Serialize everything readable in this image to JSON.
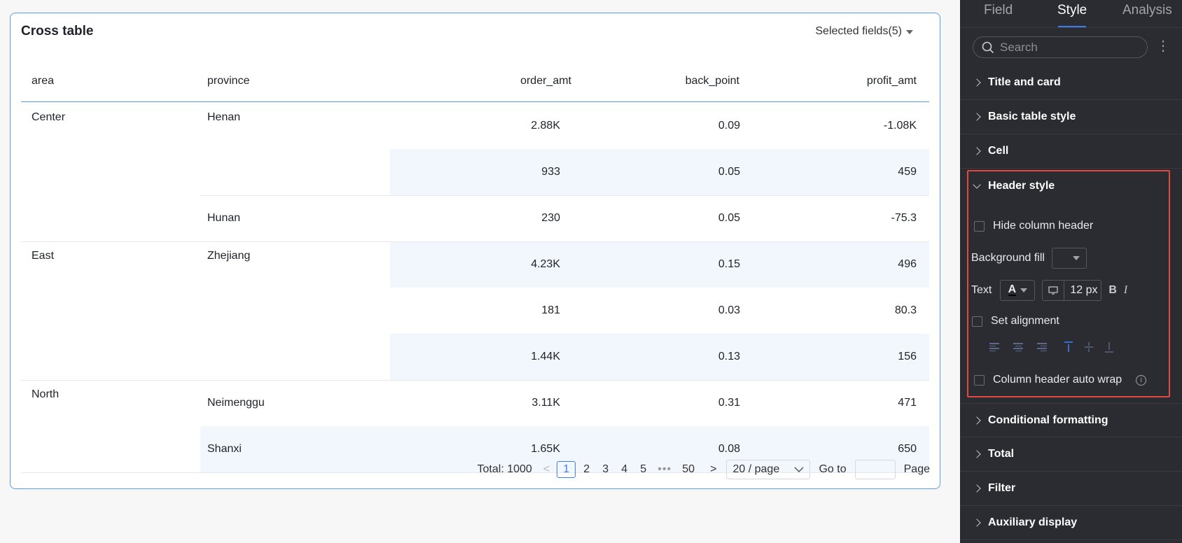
{
  "card": {
    "title": "Cross table",
    "selected_fields": "Selected fields(5)"
  },
  "table": {
    "columns": [
      "area",
      "province",
      "order_amt",
      "back_point",
      "profit_amt"
    ],
    "rows": [
      {
        "order_amt": "2.88K",
        "back_point": "0.09",
        "profit_amt": "-1.08K"
      },
      {
        "order_amt": "933",
        "back_point": "0.05",
        "profit_amt": "459"
      },
      {
        "order_amt": "230",
        "back_point": "0.05",
        "profit_amt": "-75.3"
      },
      {
        "order_amt": "4.23K",
        "back_point": "0.15",
        "profit_amt": "496"
      },
      {
        "order_amt": "181",
        "back_point": "0.03",
        "profit_amt": "80.3"
      },
      {
        "order_amt": "1.44K",
        "back_point": "0.13",
        "profit_amt": "156"
      },
      {
        "order_amt": "3.11K",
        "back_point": "0.31",
        "profit_amt": "471"
      },
      {
        "order_amt": "1.65K",
        "back_point": "0.08",
        "profit_amt": "650"
      }
    ],
    "areas": [
      "Center",
      "East",
      "North"
    ],
    "provinces": [
      "Henan",
      "Hunan",
      "Zhejiang",
      "Neimenggu",
      "Shanxi"
    ]
  },
  "pagination": {
    "total": "Total: 1000",
    "pages": [
      "1",
      "2",
      "3",
      "4",
      "5"
    ],
    "ellipsis": "•••",
    "last_page": "50",
    "page_size": "20 / page",
    "goto_label": "Go to",
    "page_label": "Page"
  },
  "panel": {
    "tabs": [
      "Field",
      "Style",
      "Analysis"
    ],
    "search_placeholder": "Search",
    "sections": {
      "title_card": "Title and card",
      "basic_table": "Basic table style",
      "cell": "Cell",
      "header_style": "Header style",
      "conditional": "Conditional formatting",
      "total": "Total",
      "filter": "Filter",
      "auxiliary": "Auxiliary display"
    },
    "header_options": {
      "hide_column_header": "Hide column header",
      "background_fill": "Background fill",
      "text": "Text",
      "font_letter": "A",
      "font_size": "12 px",
      "bold": "B",
      "italic": "I",
      "set_alignment": "Set alignment",
      "auto_wrap": "Column header auto wrap"
    }
  },
  "colors": {
    "accent": "#3b7ff0",
    "highlight": "#e2493f",
    "panel_bg": "#2b2c31",
    "row_shade": "#f2f6fd"
  }
}
